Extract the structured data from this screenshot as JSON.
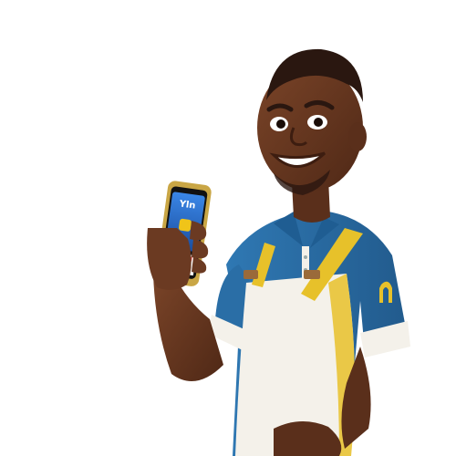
{
  "scene": {
    "subject": "smiling-man-holding-phone",
    "background": "#ffffff"
  },
  "phone": {
    "screen_label": "Yln",
    "app_icon": "wallet-icon"
  },
  "colors": {
    "skin": "#6b3a22",
    "skin_shadow": "#4a2514",
    "hair": "#2a1710",
    "shirt_blue": "#2b6fa8",
    "shirt_white": "#f4f1ea",
    "strap_yellow": "#e7c12a",
    "phone_screen": "#2a6fd1",
    "phone_frame": "#c9a645"
  }
}
